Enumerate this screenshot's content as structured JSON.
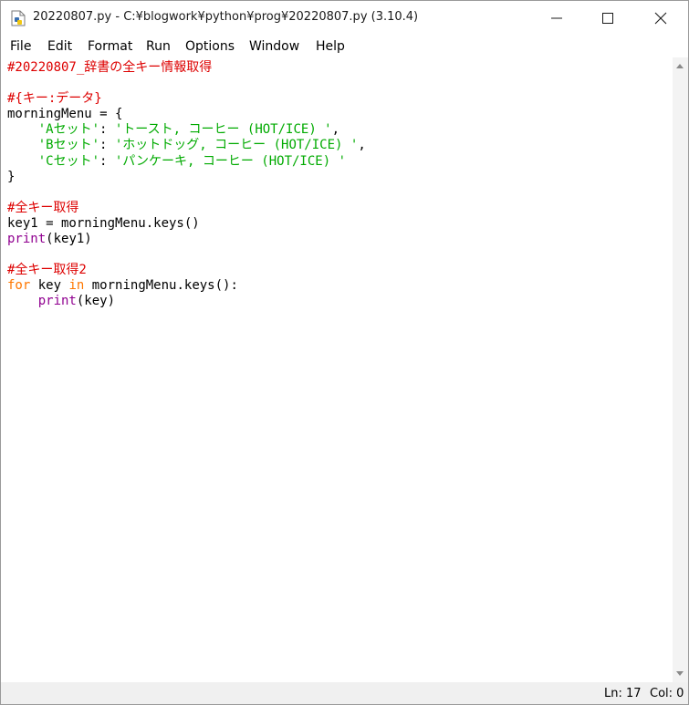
{
  "window": {
    "title": "20220807.py - C:¥blogwork¥python¥prog¥20220807.py (3.10.4)"
  },
  "menu": [
    {
      "label": "File"
    },
    {
      "label": "Edit"
    },
    {
      "label": "Format"
    },
    {
      "label": "Run"
    },
    {
      "label": "Options"
    },
    {
      "label": "Window"
    },
    {
      "label": "Help"
    }
  ],
  "code": {
    "l1": "#20220807_辞書の全キー情報取得",
    "l3": "#{キー:データ}",
    "l4": "morningMenu = {",
    "l5_key": "'Aセット'",
    "l5_sep": ": ",
    "l5_val": "'トースト, コーヒー (HOT/ICE) '",
    "l6_key": "'Bセット'",
    "l6_sep": ": ",
    "l6_val": "'ホットドッグ, コーヒー (HOT/ICE) '",
    "l7_key": "'Cセット'",
    "l7_sep": ": ",
    "l7_val": "'パンケーキ, コーヒー (HOT/ICE) '",
    "l8": "}",
    "l10": "#全キー取得",
    "l11": "key1 = morningMenu.keys()",
    "l12_fn": "print",
    "l12_rest": "(key1)",
    "l14": "#全キー取得2",
    "l15_for": "for",
    "l15_mid": " key ",
    "l15_in": "in",
    "l15_rest": " morningMenu.keys():",
    "l16_fn": "print",
    "l16_rest": "(key)"
  },
  "status": {
    "line": "Ln: 17",
    "col": "Col: 0"
  }
}
